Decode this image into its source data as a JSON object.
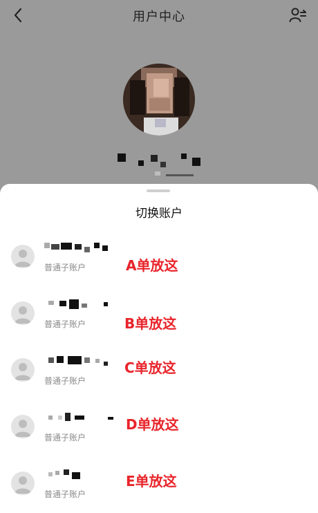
{
  "header": {
    "title": "用户中心"
  },
  "sheet": {
    "title": "切换账户",
    "accounts": [
      {
        "type": "普通子账户",
        "note": "A单放这"
      },
      {
        "type": "普通子账户",
        "note": "B单放这"
      },
      {
        "type": "普通子账户",
        "note": "C单放这"
      },
      {
        "type": "普通子账户",
        "note": "D单放这"
      },
      {
        "type": "普通子账户",
        "note": "E单放这"
      }
    ]
  },
  "colors": {
    "overlay_bg": "#9a9a9a",
    "note_red": "#e8242a",
    "avatar_placeholder": "#e3e3e3"
  },
  "icons": [
    "back-arrow-icon",
    "switch-user-icon",
    "default-avatar-icon"
  ]
}
